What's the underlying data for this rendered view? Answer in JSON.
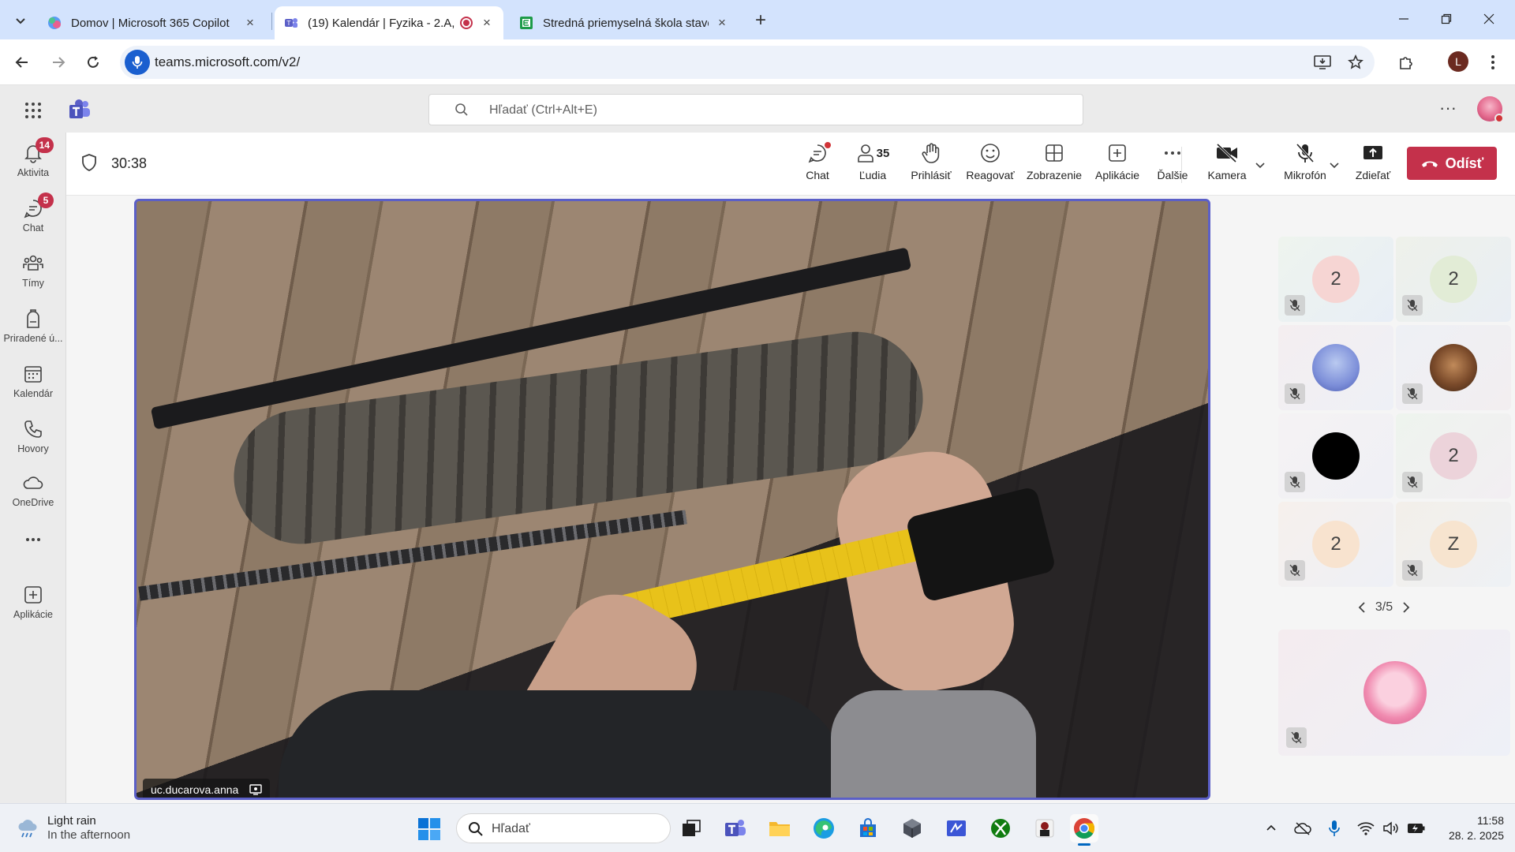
{
  "browser": {
    "tabs": [
      {
        "label": "Domov | Microsoft 365 Copilot",
        "icon": "copilot-icon",
        "active": false
      },
      {
        "label": "(19) Kalendár | Fyzika - 2.A,",
        "icon": "teams-icon",
        "active": true
      },
      {
        "label": "Stredná priemyselná škola stave",
        "icon": "edupage-icon",
        "active": false
      }
    ],
    "url": "teams.microsoft.com/v2/",
    "profile_initial": "L"
  },
  "teams": {
    "search_placeholder": "Hľadať (Ctrl+Alt+E)",
    "rail": [
      {
        "label": "Aktivita",
        "icon": "bell-icon",
        "badge": "14"
      },
      {
        "label": "Chat",
        "icon": "chat-icon",
        "badge": "5"
      },
      {
        "label": "Tímy",
        "icon": "teams-group-icon",
        "badge": ""
      },
      {
        "label": "Priradené ú...",
        "icon": "backpack-icon",
        "badge": ""
      },
      {
        "label": "Kalendár",
        "icon": "calendar-icon",
        "badge": ""
      },
      {
        "label": "Hovory",
        "icon": "phone-icon",
        "badge": ""
      },
      {
        "label": "OneDrive",
        "icon": "cloud-icon",
        "badge": ""
      },
      {
        "label": "Aplikácie",
        "icon": "add-app-icon",
        "badge": ""
      }
    ]
  },
  "meeting": {
    "timer": "30:38",
    "controls": {
      "chat": "Chat",
      "people": "Ľudia",
      "people_count": "35",
      "raise": "Prihlásiť",
      "react": "Reagovať",
      "view": "Zobrazenie",
      "apps": "Aplikácie",
      "more": "Ďalšie",
      "camera": "Kamera",
      "mic": "Mikrofón",
      "share": "Zdieľať",
      "leave": "Odísť"
    },
    "presenter_name": "uc.ducarova.anna",
    "participants": [
      {
        "initial": "2",
        "bg": "#f6d5d3",
        "avatar_type": "initial"
      },
      {
        "initial": "2",
        "bg": "#e2ecd6",
        "avatar_type": "initial"
      },
      {
        "initial": "",
        "bg": "#c9d7ef",
        "avatar_type": "cartoon-girl"
      },
      {
        "initial": "",
        "bg": "#7a4a2a",
        "avatar_type": "dog-photo"
      },
      {
        "initial": "",
        "bg": "#000000",
        "avatar_type": "black"
      },
      {
        "initial": "2",
        "bg": "#ecd3da",
        "avatar_type": "initial"
      },
      {
        "initial": "2",
        "bg": "#f8e3cf",
        "avatar_type": "initial"
      },
      {
        "initial": "Z",
        "bg": "#f7e4cf",
        "avatar_type": "initial"
      }
    ],
    "pager": "3/5"
  },
  "taskbar": {
    "weather_title": "Light rain",
    "weather_subtitle": "In the afternoon",
    "search_placeholder": "Hľadať",
    "time": "11:58",
    "date": "28. 2. 2025"
  },
  "colors": {
    "teams_accent": "#5b5fc7",
    "leave_red": "#c4314b",
    "chrome_tabstrip": "#d3e3fd"
  }
}
